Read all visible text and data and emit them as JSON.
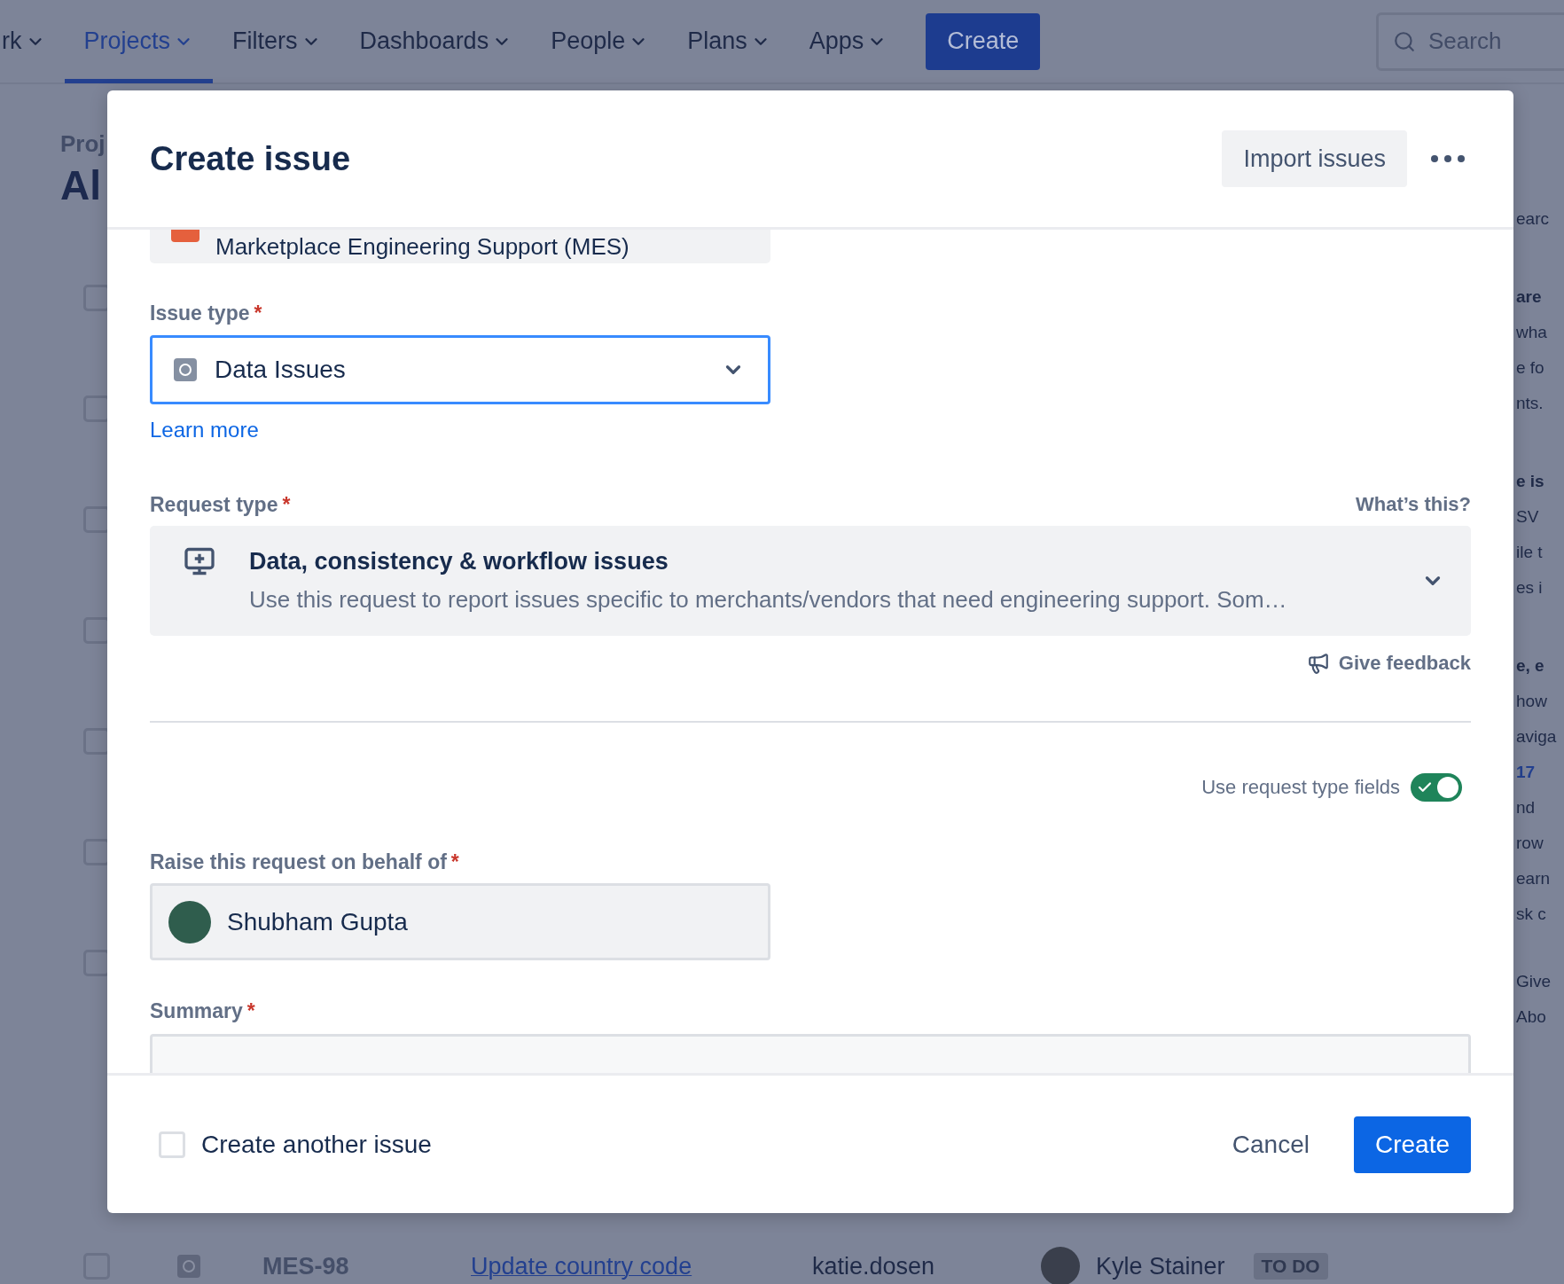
{
  "top_nav": {
    "items": [
      {
        "label": "rk",
        "selected": false
      },
      {
        "label": "Projects",
        "selected": true
      },
      {
        "label": "Filters",
        "selected": false
      },
      {
        "label": "Dashboards",
        "selected": false
      },
      {
        "label": "People",
        "selected": false
      },
      {
        "label": "Plans",
        "selected": false
      },
      {
        "label": "Apps",
        "selected": false
      }
    ],
    "create_button": "Create",
    "search": {
      "placeholder": "Search"
    }
  },
  "background_page": {
    "breadcrumb": "Proj",
    "heading": "Al",
    "row_checkboxes": [
      {
        "checked": false
      },
      {
        "checked": false
      },
      {
        "checked": false
      },
      {
        "checked": false
      },
      {
        "checked": false
      },
      {
        "checked": false
      },
      {
        "checked": false
      }
    ],
    "bottom_row": {
      "checked": false,
      "key": "MES-98",
      "summary": "Update country code",
      "reporter": "katie.dosen",
      "assignee": "Kyle Stainer",
      "status": "TO DO"
    },
    "side_panel": [
      {
        "kind": "field",
        "text": "earc"
      },
      {
        "kind": "heading",
        "text": "are"
      },
      {
        "kind": "text",
        "text": "wha"
      },
      {
        "kind": "text",
        "text": "e fo"
      },
      {
        "kind": "text",
        "text": "nts."
      },
      {
        "kind": "heading",
        "text": "e is"
      },
      {
        "kind": "text",
        "text": "SV"
      },
      {
        "kind": "text",
        "text": "ile t"
      },
      {
        "kind": "text",
        "text": "es i"
      },
      {
        "kind": "heading",
        "text": "e, e"
      },
      {
        "kind": "text",
        "text": "how"
      },
      {
        "kind": "text",
        "text": "aviga"
      },
      {
        "kind": "link",
        "text": "17"
      },
      {
        "kind": "text",
        "text": "nd"
      },
      {
        "kind": "text",
        "text": "row"
      },
      {
        "kind": "text",
        "text": "earn"
      },
      {
        "kind": "text",
        "text": "sk c"
      },
      {
        "kind": "feedback",
        "text": "Give"
      },
      {
        "kind": "text",
        "text": "Abo"
      }
    ]
  },
  "dialog": {
    "title": "Create issue",
    "import_button": "Import issues",
    "project_field": {
      "value": "Marketplace Engineering Support (MES)"
    },
    "issue_type": {
      "label": "Issue type",
      "required_mark": "*",
      "value": "Data Issues",
      "focused": true
    },
    "learn_more": "Learn more",
    "request_type": {
      "label": "Request type",
      "required_mark": "*",
      "help_link": "What’s this?",
      "title": "Data, consistency & workflow issues",
      "description": "Use this request to report issues specific to merchants/vendors that need engineering support. Som…"
    },
    "give_feedback": "Give feedback",
    "request_type_fields_toggle": {
      "label": "Use request type fields",
      "on": true
    },
    "on_behalf_of": {
      "label": "Raise this request on behalf of",
      "required_mark": "*",
      "value": "Shubham Gupta"
    },
    "summary": {
      "label": "Summary",
      "required_mark": "*"
    },
    "create_another": {
      "label": "Create another issue",
      "checked": false
    },
    "cancel_button": "Cancel",
    "create_button": "Create"
  }
}
